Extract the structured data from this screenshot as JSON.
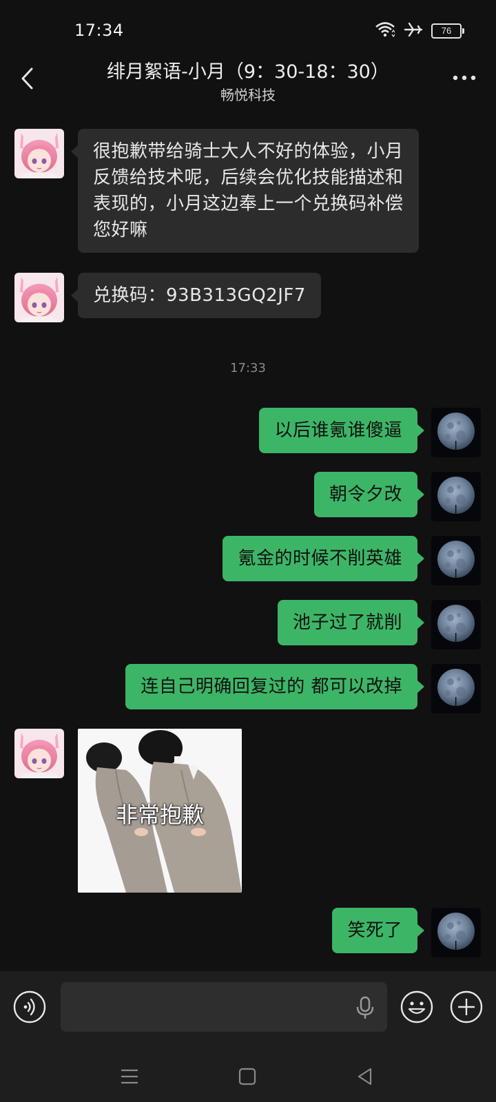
{
  "status_bar": {
    "time": "17:34",
    "battery": "76"
  },
  "header": {
    "title": "绯月絮语-小月（9：30-18：30）",
    "subtitle": "畅悦科技"
  },
  "messages": {
    "m1": "很抱歉带给骑士大人不好的体验，小月反馈给技术呢，后续会优化技能描述和表现的，小月这边奉上一个兑换码补偿您好嘛",
    "m2": "兑换码：93B313GQ2JF7",
    "timestamp": "17:33",
    "m3": "以后谁氪谁傻逼",
    "m4": "朝令夕改",
    "m5": "氪金的时候不削英雄",
    "m6": "池子过了就削",
    "m7": "连自己明确回复过的 都可以改掉",
    "sticker_text": "非常抱歉",
    "m8": "笑死了"
  },
  "input": {
    "placeholder": ""
  },
  "colors": {
    "outgoing_bubble": "#3db566",
    "incoming_bubble": "#2c2c2c",
    "background": "#111111"
  },
  "icons": [
    "wifi-icon",
    "airplane-icon",
    "battery-icon",
    "back-icon",
    "more-icon",
    "voice-icon",
    "mic-icon",
    "emoji-icon",
    "plus-icon",
    "menu-icon",
    "home-icon",
    "back-nav-icon"
  ]
}
